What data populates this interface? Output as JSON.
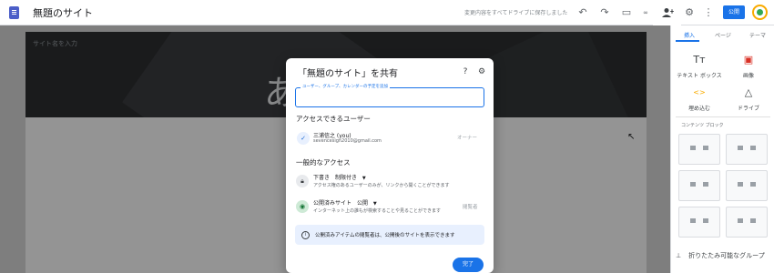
{
  "app": {
    "title": "無題のサイト",
    "saved_status": "変更内容をすべてドライブに保存しました",
    "publish_label": "公開"
  },
  "toolbar": {
    "icons": [
      "doc-icon",
      "undo-icon",
      "redo-icon",
      "preview-icon",
      "share-icon",
      "settings-icon",
      "more-icon"
    ]
  },
  "editor": {
    "site_name_placeholder": "サイト名を入力",
    "hero_text": "あ"
  },
  "panel": {
    "tabs": [
      "挿入",
      "ページ",
      "テーマ"
    ],
    "active_tab": "挿入",
    "insert_items": [
      {
        "label": "テキスト ボックス",
        "icon": "text-box-icon",
        "glyph": "Tт"
      },
      {
        "label": "画像",
        "icon": "image-icon",
        "glyph": "▣"
      },
      {
        "label": "埋め込む",
        "icon": "embed-icon",
        "glyph": "<>"
      },
      {
        "label": "ドライブ",
        "icon": "drive-icon",
        "glyph": "△"
      }
    ],
    "section_label": "コンテンツ ブロック",
    "collapse_label": "折りたたみ可能なグループ"
  },
  "dialog": {
    "title": "「無題のサイト」を共有",
    "input_label": "ユーザー、グループ、カレンダーの予定を追加",
    "access_header": "アクセスできるユーザー",
    "user": {
      "initial": "✓",
      "name": "三浦信之 (you)",
      "email": "sevencesign2010@gmail.com",
      "role": "オーナー"
    },
    "general_header": "一般的なアクセス",
    "draft": {
      "title": "下書き",
      "setting": "制限付き",
      "description": "アクセス権のあるユーザーのみが、リンクから開くことができます"
    },
    "published": {
      "title": "公開済みサイト",
      "setting": "公開",
      "description": "インターネット上の誰もが検索することや見ることができます",
      "role": "閲覧者"
    },
    "info_text": "公開済みアイテムの閲覧者は、公開後のサイトを表示できます",
    "done_label": "完了"
  },
  "colors": {
    "accent": "#1a73e8",
    "banner": "#e8f0fe",
    "hero": "#2d2f31"
  }
}
